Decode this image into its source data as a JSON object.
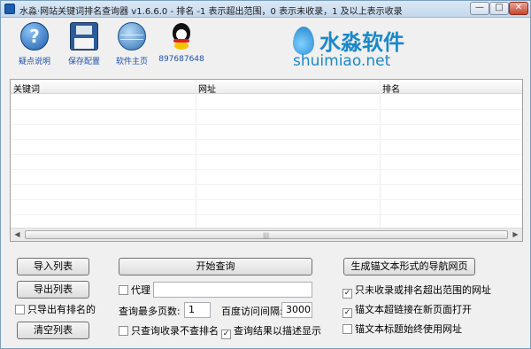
{
  "window": {
    "title": "水淼·网站关键词排名查询器 v1.6.6.0 - 排名 -1 表示超出范围，0 表示未收录，1 及以上表示收录",
    "min_glyph": "—",
    "max_glyph": "□",
    "close_glyph": "✕"
  },
  "toolbar": {
    "items": [
      {
        "label": "疑点说明",
        "icon": "help-icon"
      },
      {
        "label": "保存配置",
        "icon": "save-icon"
      },
      {
        "label": "软件主页",
        "icon": "globe-icon"
      },
      {
        "label": "897687648",
        "icon": "qq-icon"
      }
    ],
    "help_glyph": "?"
  },
  "logo": {
    "cn": "水淼软件",
    "en": "shuimiao.net"
  },
  "table": {
    "columns": [
      "关键词",
      "网址",
      "排名"
    ],
    "rows": [],
    "scroll_left": "◀",
    "scroll_right": "▶",
    "scroll_grip": "|||"
  },
  "left_panel": {
    "import_label": "导入列表",
    "export_label": "导出列表",
    "export_ranked_only": {
      "label": "只导出有排名的",
      "checked": false
    },
    "clear_label": "清空列表"
  },
  "middle_panel": {
    "start_label": "开始查询",
    "proxy": {
      "label": "代理",
      "checked": false,
      "value": ""
    },
    "max_pages_label": "查询最多页数:",
    "max_pages_value": "1",
    "interval_label": "百度访问间隔:",
    "interval_value": "3000",
    "only_indexed": {
      "label": "只查询收录不查排名",
      "checked": false
    },
    "result_desc": {
      "label": "查询结果以描述显示",
      "checked": true
    }
  },
  "right_panel": {
    "gen_nav_label": "生成锚文本形式的导航网页",
    "only_unranked": {
      "label": "只未收录或排名超出范围的网址",
      "checked": true
    },
    "new_window": {
      "label": "锚文本超链接在新页面打开",
      "checked": true
    },
    "title_as_url": {
      "label": "锚文本标题始终使用网址",
      "checked": false
    }
  }
}
